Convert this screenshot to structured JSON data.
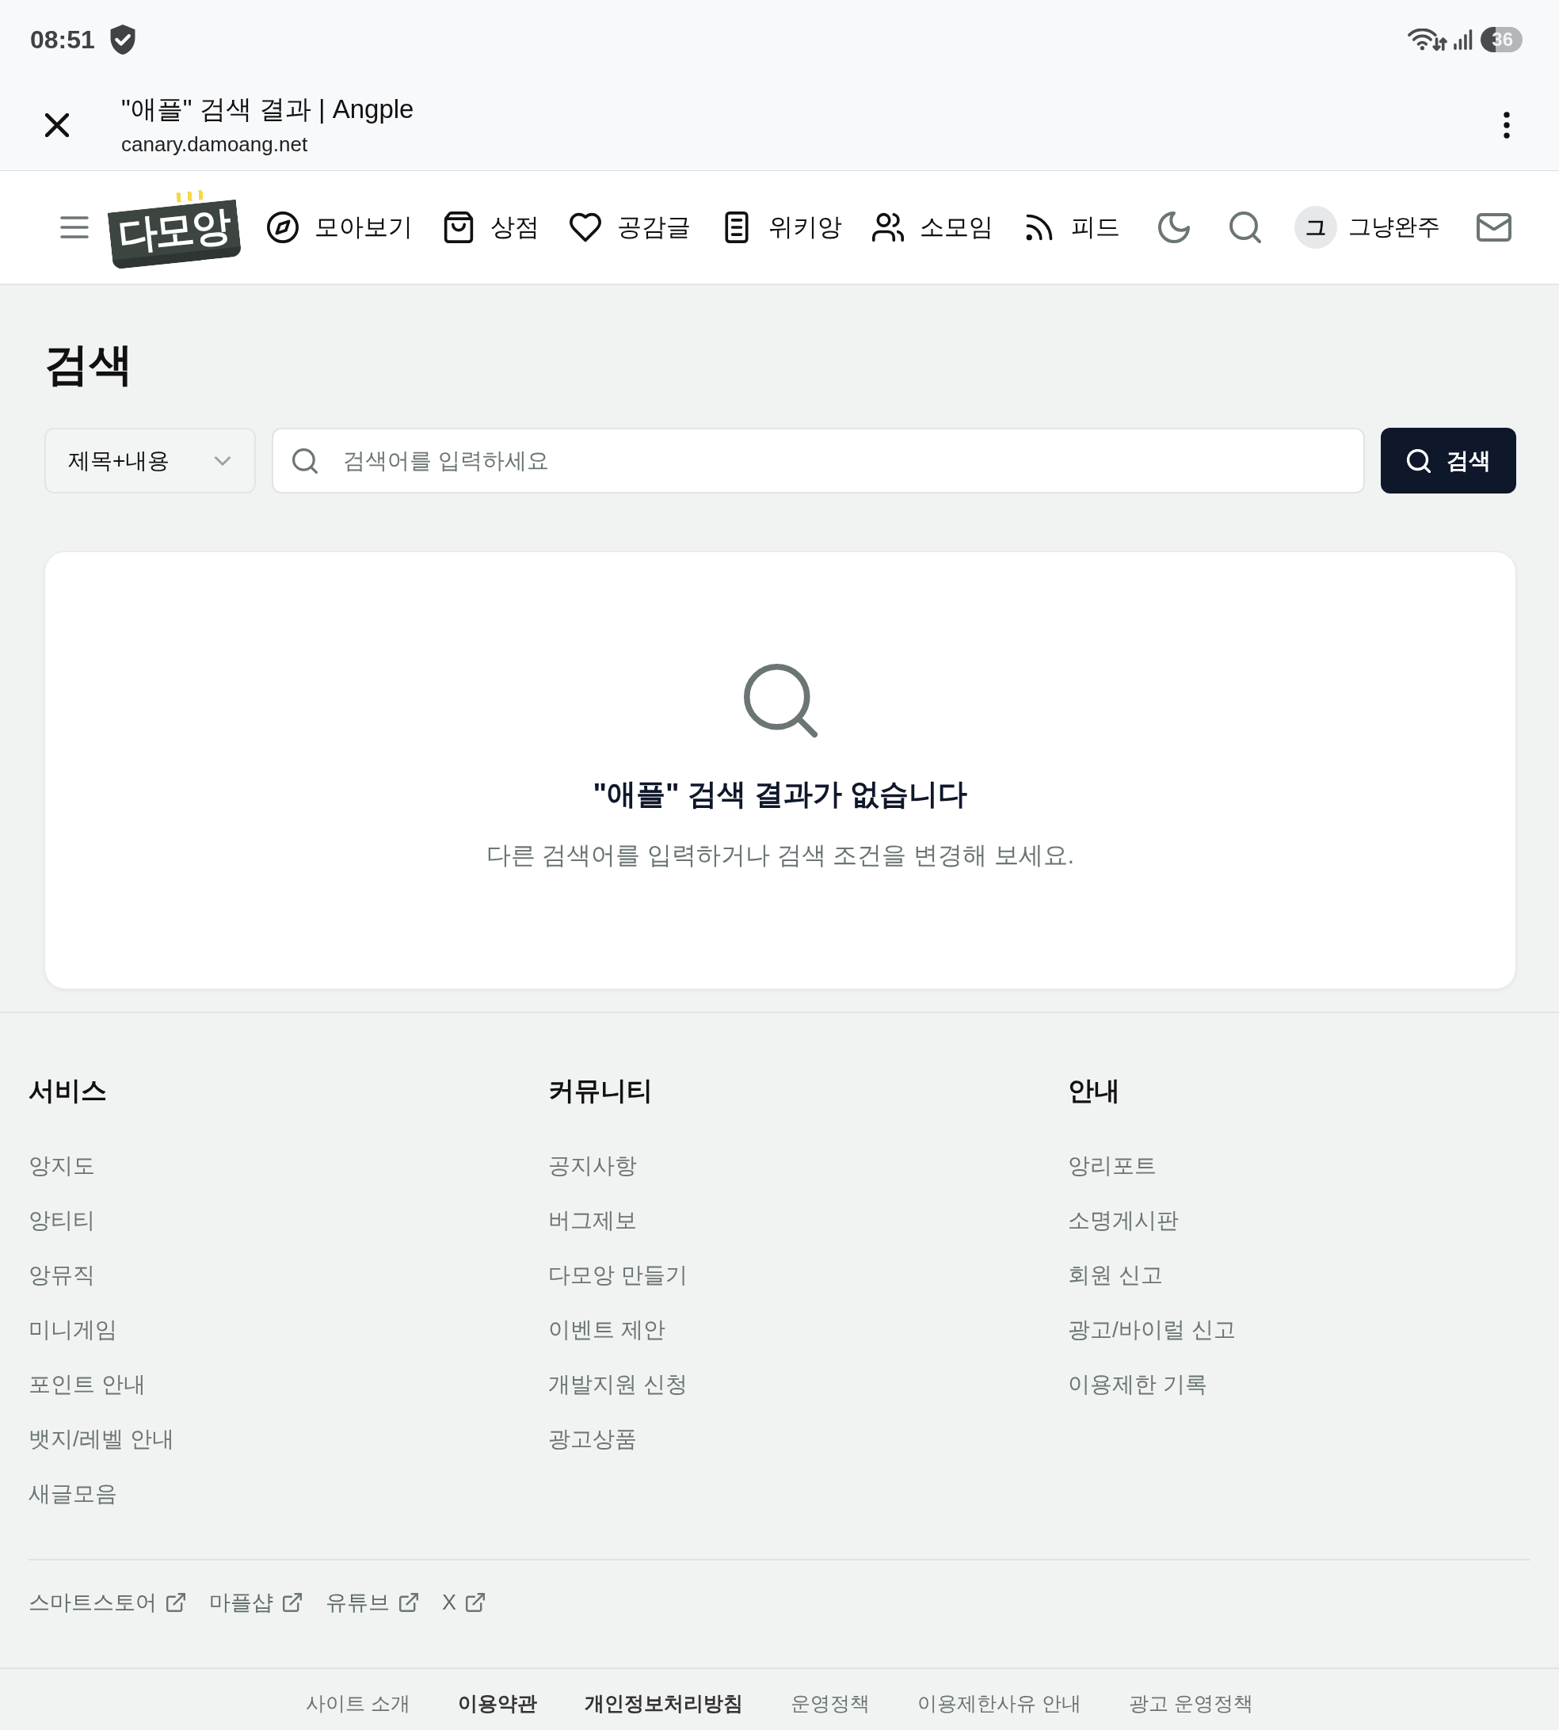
{
  "status_bar": {
    "time": "08:51",
    "battery": "36"
  },
  "browser_bar": {
    "title": "\"애플\" 검색 결과 | Angple",
    "url": "canary.damoang.net"
  },
  "site_header": {
    "logo": "다모앙",
    "nav": [
      {
        "label": "모아보기"
      },
      {
        "label": "상점"
      },
      {
        "label": "공감글"
      },
      {
        "label": "위키앙"
      },
      {
        "label": "소모임"
      },
      {
        "label": "피드"
      }
    ],
    "user": {
      "avatar": "그",
      "name": "그냥완주"
    }
  },
  "page": {
    "title": "검색",
    "search": {
      "scope": "제목+내용",
      "placeholder": "검색어를 입력하세요",
      "button": "검색"
    },
    "empty_state": {
      "title": "\"애플\" 검색 결과가 없습니다",
      "message": "다른 검색어를 입력하거나 검색 조건을 변경해 보세요."
    }
  },
  "footer": {
    "columns": [
      {
        "heading": "서비스",
        "links": [
          "앙지도",
          "앙티티",
          "앙뮤직",
          "미니게임",
          "포인트 안내",
          "뱃지/레벨 안내",
          "새글모음"
        ]
      },
      {
        "heading": "커뮤니티",
        "links": [
          "공지사항",
          "버그제보",
          "다모앙 만들기",
          "이벤트 제안",
          "개발지원 신청",
          "광고상품"
        ]
      },
      {
        "heading": "안내",
        "links": [
          "앙리포트",
          "소명게시판",
          "회원 신고",
          "광고/바이럴 신고",
          "이용제한 기록"
        ]
      }
    ],
    "external_links": [
      "스마트스토어",
      "마플샵",
      "유튜브",
      "X"
    ],
    "legal_links": [
      {
        "label": "사이트 소개",
        "bold": false
      },
      {
        "label": "이용약관",
        "bold": true
      },
      {
        "label": "개인정보처리방침",
        "bold": true
      },
      {
        "label": "운영정책",
        "bold": false
      },
      {
        "label": "이용제한사유 안내",
        "bold": false
      },
      {
        "label": "광고 운영정책",
        "bold": false
      }
    ]
  }
}
